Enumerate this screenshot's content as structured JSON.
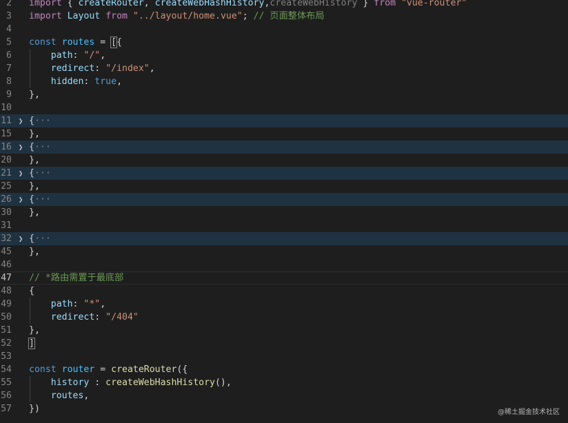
{
  "editor": {
    "lines": [
      {
        "num": "2",
        "fold": "",
        "folded": false,
        "current": false,
        "guide": false,
        "tokens": [
          {
            "t": "import",
            "c": "kc"
          },
          {
            "t": " { ",
            "c": "pn"
          },
          {
            "t": "createRouter",
            "c": "vr"
          },
          {
            "t": ", ",
            "c": "pn"
          },
          {
            "t": "createWebHashHistory",
            "c": "vr"
          },
          {
            "t": ",",
            "c": "pn"
          },
          {
            "t": "createWebHistory",
            "c": "gy"
          },
          {
            "t": " } ",
            "c": "pn"
          },
          {
            "t": "from",
            "c": "kc"
          },
          {
            "t": " ",
            "c": "pn"
          },
          {
            "t": "\"vue-router\"",
            "c": "st"
          }
        ]
      },
      {
        "num": "3",
        "fold": "",
        "folded": false,
        "current": false,
        "guide": false,
        "tokens": [
          {
            "t": "import",
            "c": "kc"
          },
          {
            "t": " ",
            "c": "pn"
          },
          {
            "t": "Layout",
            "c": "vr"
          },
          {
            "t": " ",
            "c": "pn"
          },
          {
            "t": "from",
            "c": "kc"
          },
          {
            "t": " ",
            "c": "pn"
          },
          {
            "t": "\"../layout/home.vue\"",
            "c": "st"
          },
          {
            "t": "; ",
            "c": "pn"
          },
          {
            "t": "// 页面整体布局",
            "c": "cm"
          }
        ]
      },
      {
        "num": "4",
        "fold": "",
        "folded": false,
        "current": false,
        "guide": false,
        "tokens": []
      },
      {
        "num": "5",
        "fold": "",
        "folded": false,
        "current": false,
        "guide": false,
        "tokens": [
          {
            "t": "const",
            "c": "kw"
          },
          {
            "t": " ",
            "c": "pn"
          },
          {
            "t": "routes",
            "c": "ct"
          },
          {
            "t": " = ",
            "c": "pn"
          },
          {
            "t": "[",
            "c": "bk"
          },
          {
            "t": "{",
            "c": "pn"
          }
        ]
      },
      {
        "num": "6",
        "fold": "",
        "folded": false,
        "current": false,
        "guide": true,
        "tokens": [
          {
            "t": "    ",
            "c": "pn"
          },
          {
            "t": "path",
            "c": "vr"
          },
          {
            "t": ": ",
            "c": "pn"
          },
          {
            "t": "\"/\"",
            "c": "st"
          },
          {
            "t": ",",
            "c": "pn"
          }
        ]
      },
      {
        "num": "7",
        "fold": "",
        "folded": false,
        "current": false,
        "guide": true,
        "tokens": [
          {
            "t": "    ",
            "c": "pn"
          },
          {
            "t": "redirect",
            "c": "vr"
          },
          {
            "t": ": ",
            "c": "pn"
          },
          {
            "t": "\"/index\"",
            "c": "st"
          },
          {
            "t": ",",
            "c": "pn"
          }
        ]
      },
      {
        "num": "8",
        "fold": "",
        "folded": false,
        "current": false,
        "guide": true,
        "tokens": [
          {
            "t": "    ",
            "c": "pn"
          },
          {
            "t": "hidden",
            "c": "vr"
          },
          {
            "t": ": ",
            "c": "pn"
          },
          {
            "t": "true",
            "c": "kw"
          },
          {
            "t": ",",
            "c": "pn"
          }
        ]
      },
      {
        "num": "9",
        "fold": "",
        "folded": false,
        "current": false,
        "guide": false,
        "tokens": [
          {
            "t": "},",
            "c": "pn"
          }
        ]
      },
      {
        "num": "10",
        "fold": "",
        "folded": false,
        "current": false,
        "guide": false,
        "tokens": []
      },
      {
        "num": "11",
        "fold": ">",
        "folded": true,
        "current": false,
        "guide": false,
        "tokens": [
          {
            "t": "{",
            "c": "pn"
          },
          {
            "t": "···",
            "c": "gy"
          }
        ]
      },
      {
        "num": "15",
        "fold": "",
        "folded": false,
        "current": false,
        "guide": false,
        "tokens": [
          {
            "t": "},",
            "c": "pn"
          }
        ]
      },
      {
        "num": "16",
        "fold": ">",
        "folded": true,
        "current": false,
        "guide": false,
        "tokens": [
          {
            "t": "{",
            "c": "pn"
          },
          {
            "t": "···",
            "c": "gy"
          }
        ]
      },
      {
        "num": "20",
        "fold": "",
        "folded": false,
        "current": false,
        "guide": false,
        "tokens": [
          {
            "t": "},",
            "c": "pn"
          }
        ]
      },
      {
        "num": "21",
        "fold": ">",
        "folded": true,
        "current": false,
        "guide": false,
        "tokens": [
          {
            "t": "{",
            "c": "pn"
          },
          {
            "t": "···",
            "c": "gy"
          }
        ]
      },
      {
        "num": "25",
        "fold": "",
        "folded": false,
        "current": false,
        "guide": false,
        "tokens": [
          {
            "t": "},",
            "c": "pn"
          }
        ]
      },
      {
        "num": "26",
        "fold": ">",
        "folded": true,
        "current": false,
        "guide": false,
        "tokens": [
          {
            "t": "{",
            "c": "pn"
          },
          {
            "t": "···",
            "c": "gy"
          }
        ]
      },
      {
        "num": "30",
        "fold": "",
        "folded": false,
        "current": false,
        "guide": false,
        "tokens": [
          {
            "t": "},",
            "c": "pn"
          }
        ]
      },
      {
        "num": "31",
        "fold": "",
        "folded": false,
        "current": false,
        "guide": false,
        "tokens": []
      },
      {
        "num": "32",
        "fold": ">",
        "folded": true,
        "current": false,
        "guide": false,
        "tokens": [
          {
            "t": "{",
            "c": "pn"
          },
          {
            "t": "···",
            "c": "gy"
          }
        ]
      },
      {
        "num": "45",
        "fold": "",
        "folded": false,
        "current": false,
        "guide": false,
        "tokens": [
          {
            "t": "},",
            "c": "pn"
          }
        ]
      },
      {
        "num": "46",
        "fold": "",
        "folded": false,
        "current": false,
        "guide": false,
        "tokens": []
      },
      {
        "num": "47",
        "fold": "",
        "folded": false,
        "current": true,
        "guide": false,
        "tokens": [
          {
            "t": "// *路由需置于最底部",
            "c": "cm"
          }
        ]
      },
      {
        "num": "48",
        "fold": "",
        "folded": false,
        "current": false,
        "guide": false,
        "tokens": [
          {
            "t": "{",
            "c": "pn"
          }
        ]
      },
      {
        "num": "49",
        "fold": "",
        "folded": false,
        "current": false,
        "guide": true,
        "tokens": [
          {
            "t": "    ",
            "c": "pn"
          },
          {
            "t": "path",
            "c": "vr"
          },
          {
            "t": ": ",
            "c": "pn"
          },
          {
            "t": "\"*\"",
            "c": "st"
          },
          {
            "t": ",",
            "c": "pn"
          }
        ]
      },
      {
        "num": "50",
        "fold": "",
        "folded": false,
        "current": false,
        "guide": true,
        "tokens": [
          {
            "t": "    ",
            "c": "pn"
          },
          {
            "t": "redirect",
            "c": "vr"
          },
          {
            "t": ": ",
            "c": "pn"
          },
          {
            "t": "\"/404\"",
            "c": "st"
          }
        ]
      },
      {
        "num": "51",
        "fold": "",
        "folded": false,
        "current": false,
        "guide": false,
        "tokens": [
          {
            "t": "},",
            "c": "pn"
          }
        ]
      },
      {
        "num": "52",
        "fold": "",
        "folded": false,
        "current": false,
        "guide": false,
        "tokens": [
          {
            "t": "]",
            "c": "bk"
          }
        ]
      },
      {
        "num": "53",
        "fold": "",
        "folded": false,
        "current": false,
        "guide": false,
        "tokens": []
      },
      {
        "num": "54",
        "fold": "",
        "folded": false,
        "current": false,
        "guide": false,
        "tokens": [
          {
            "t": "const",
            "c": "kw"
          },
          {
            "t": " ",
            "c": "pn"
          },
          {
            "t": "router",
            "c": "ct"
          },
          {
            "t": " = ",
            "c": "pn"
          },
          {
            "t": "createRouter",
            "c": "fn"
          },
          {
            "t": "({",
            "c": "pn"
          }
        ]
      },
      {
        "num": "55",
        "fold": "",
        "folded": false,
        "current": false,
        "guide": true,
        "tokens": [
          {
            "t": "    ",
            "c": "pn"
          },
          {
            "t": "history",
            "c": "vr"
          },
          {
            "t": " : ",
            "c": "pn"
          },
          {
            "t": "createWebHashHistory",
            "c": "fn"
          },
          {
            "t": "(),",
            "c": "pn"
          }
        ]
      },
      {
        "num": "56",
        "fold": "",
        "folded": false,
        "current": false,
        "guide": true,
        "tokens": [
          {
            "t": "    ",
            "c": "pn"
          },
          {
            "t": "routes",
            "c": "vr"
          },
          {
            "t": ",",
            "c": "pn"
          }
        ]
      },
      {
        "num": "57",
        "fold": "",
        "folded": false,
        "current": false,
        "guide": false,
        "tokens": [
          {
            "t": "})",
            "c": "pn"
          }
        ]
      }
    ]
  },
  "watermark": "@稀土掘金技术社区"
}
